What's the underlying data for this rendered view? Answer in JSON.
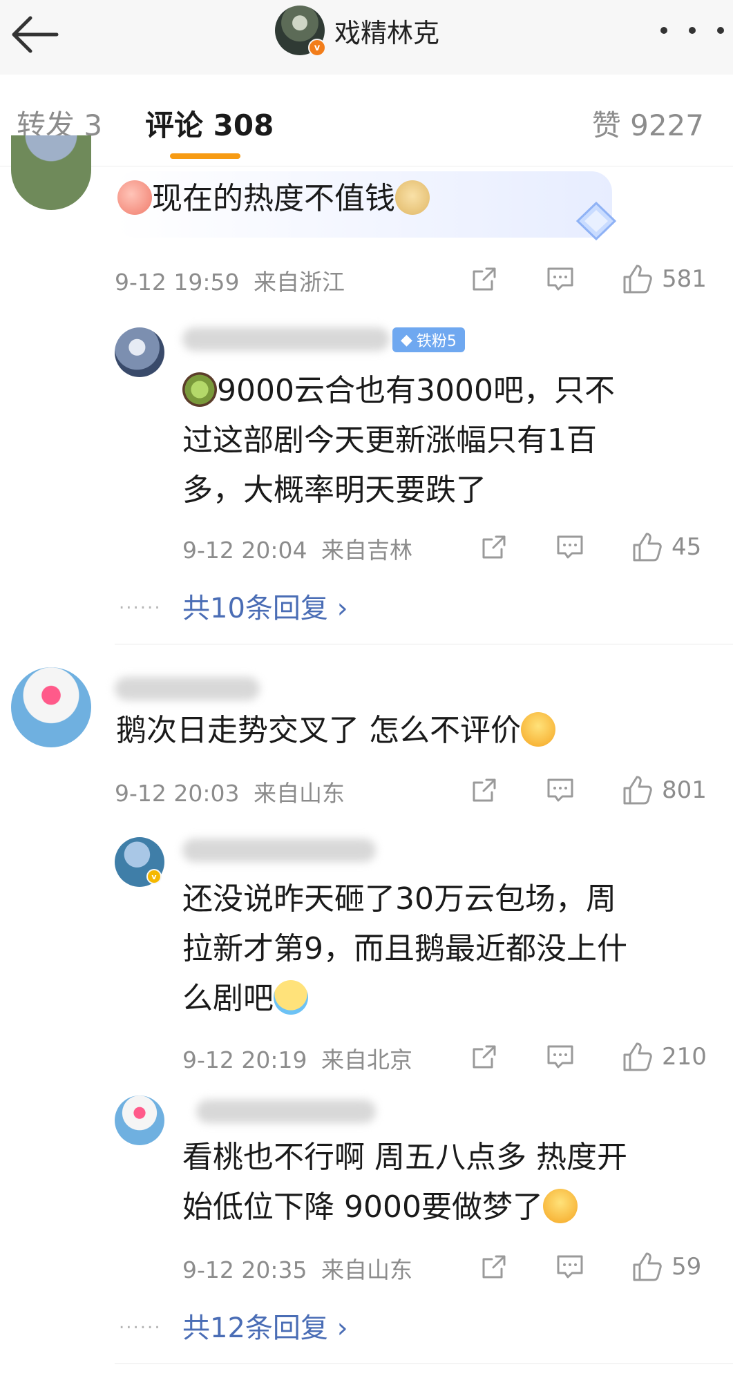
{
  "header": {
    "title": "戏精林克",
    "verified_badge": "v"
  },
  "tabs": {
    "repost": "转发 3",
    "comment": "评论 308",
    "like": "赞 9227"
  },
  "comments": [
    {
      "text": "现在的热度不值钱",
      "time": "9-12 19:59",
      "location": "来自浙江",
      "likes": "581"
    },
    {
      "text_lines": [
        "9000云合也有3000吧，只不",
        "过这部剧今天更新涨幅只有1百",
        "多，大概率明天要跌了"
      ],
      "badge": "铁粉5",
      "time": "9-12 20:04",
      "location": "来自吉林",
      "likes": "45",
      "more_replies": "共10条回复 ›"
    },
    {
      "text": "鹅次日走势交叉了 怎么不评价",
      "time": "9-12 20:03",
      "location": "来自山东",
      "likes": "801"
    },
    {
      "text_lines": [
        "还没说昨天砸了30万云包场，周",
        "拉新才第9，而且鹅最近都没上什",
        "么剧吧"
      ],
      "time": "9-12 20:19",
      "location": "来自北京",
      "likes": "210"
    },
    {
      "text_lines": [
        "看桃也不行啊 周五八点多 热度开",
        "始低位下降 9000要做梦了"
      ],
      "time": "9-12 20:35",
      "location": "来自山东",
      "likes": "59",
      "more_replies": "共12条回复 ›"
    }
  ],
  "dots": "......",
  "colors": {
    "accent_tab": "#f79b14",
    "link": "#4a6db5",
    "meta": "#8c8c8c"
  }
}
